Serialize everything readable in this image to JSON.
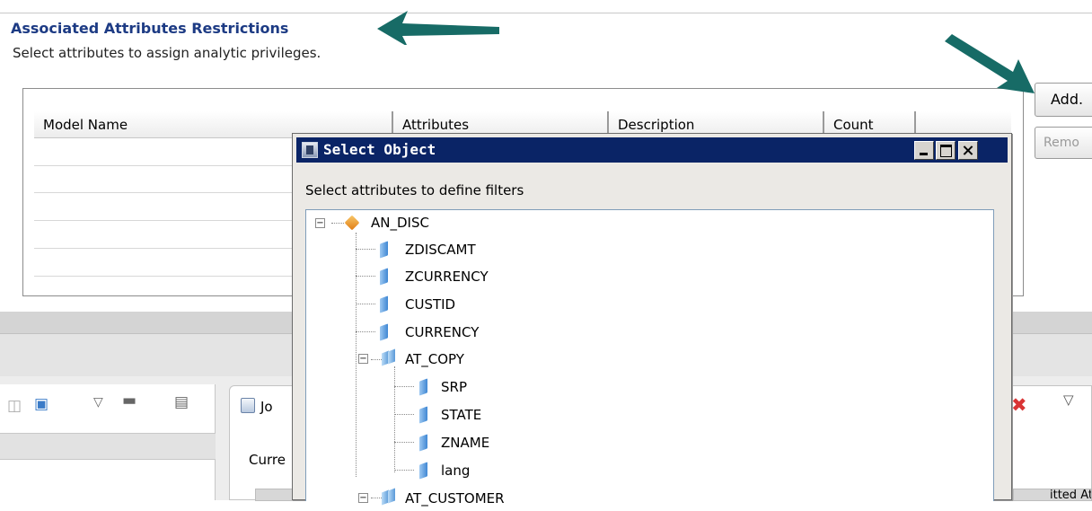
{
  "section": {
    "title": "Associated Attributes Restrictions",
    "description": "Select attributes to assign analytic privileges."
  },
  "table": {
    "columns": [
      "Model Name",
      "Attributes",
      "Description",
      "Count"
    ]
  },
  "buttons": {
    "add": "Add.",
    "remove": "Remo"
  },
  "dialog": {
    "title": "Select Object",
    "prompt": "Select attributes to define filters",
    "tree": [
      {
        "label": "AN_DISC",
        "icon": "analytic-view-icon",
        "level": 0
      },
      {
        "label": "ZDISCAMT",
        "icon": "attribute-icon",
        "level": 1
      },
      {
        "label": "ZCURRENCY",
        "icon": "attribute-icon",
        "level": 1
      },
      {
        "label": "CUSTID",
        "icon": "attribute-icon",
        "level": 1
      },
      {
        "label": "CURRENCY",
        "icon": "attribute-icon",
        "level": 1
      },
      {
        "label": "AT_COPY",
        "icon": "attribute-view-icon",
        "level": 1
      },
      {
        "label": "SRP",
        "icon": "attribute-icon",
        "level": 2
      },
      {
        "label": "STATE",
        "icon": "attribute-icon",
        "level": 2
      },
      {
        "label": "ZNAME",
        "icon": "attribute-icon",
        "level": 2
      },
      {
        "label": "lang",
        "icon": "attribute-icon",
        "level": 2
      },
      {
        "label": "AT_CUSTOMER",
        "icon": "attribute-view-icon",
        "level": 1
      }
    ]
  },
  "lower": {
    "tab_label": "Jo",
    "current_label": "Curre",
    "stub_right": "itted At"
  },
  "colors": {
    "title_blue": "#1d3b84",
    "dialog_titlebar": "#0a2466",
    "arrow": "#176b66"
  }
}
